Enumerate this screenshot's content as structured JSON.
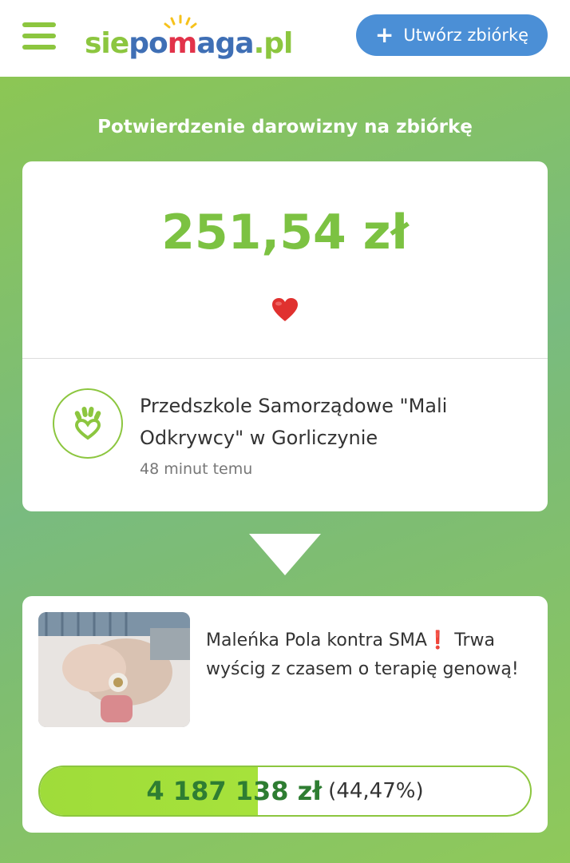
{
  "header": {
    "logo": "siepomaga.pl",
    "create_button": "Utwórz zbiórkę"
  },
  "page": {
    "heading": "Potwierdzenie darowizny na zbiórkę"
  },
  "donation": {
    "amount": "251,54 zł",
    "donor_name": "Przedszkole Samorządowe \"Mali Odkrywcy\" w Gorliczynie",
    "time_ago": "48 minut temu"
  },
  "campaign": {
    "title": "Maleńka Pola kontra SMA❗ Trwa wyścig z czasem o terapię genową!",
    "collected": "4 187 138 zł",
    "percent_text": "(44,47%)",
    "progress_fraction": 0.4447
  },
  "colors": {
    "brand_green": "#8cc63f",
    "brand_blue": "#3f6fb5",
    "button_blue": "#4b8fd6"
  },
  "icons": {
    "menu": "hamburger-icon",
    "plus": "plus-icon",
    "heart": "heart-icon",
    "org": "hand-heart-icon"
  }
}
